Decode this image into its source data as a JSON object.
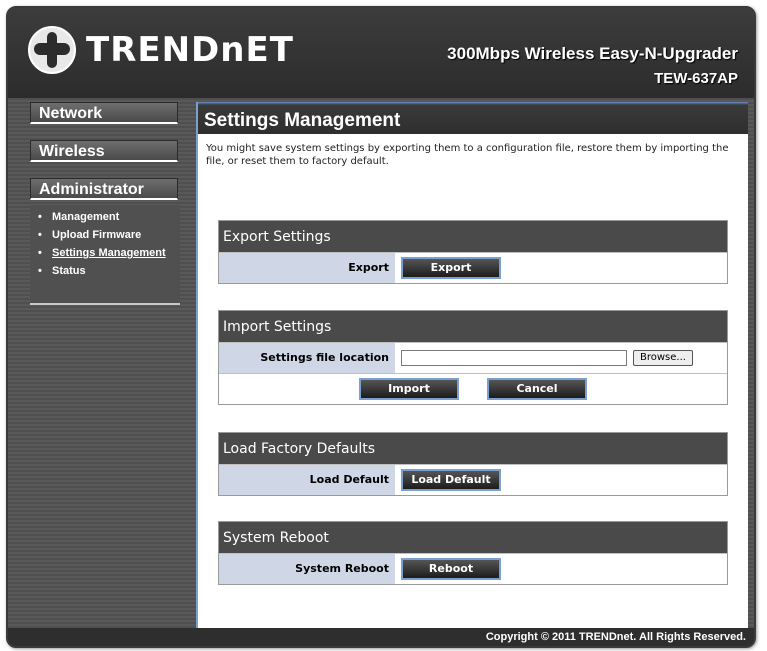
{
  "header": {
    "logo_text": "TRENDnET",
    "product_title": "300Mbps Wireless Easy-N-Upgrader",
    "model": "TEW-637AP"
  },
  "sidebar": {
    "nav": [
      {
        "label": "Network"
      },
      {
        "label": "Wireless"
      },
      {
        "label": "Administrator"
      }
    ],
    "submenu": [
      {
        "label": "Management"
      },
      {
        "label": "Upload Firmware"
      },
      {
        "label": "Settings Management"
      },
      {
        "label": "Status"
      }
    ]
  },
  "main": {
    "title": "Settings Management",
    "intro": "You might save system settings by exporting them to a configuration file, restore them by importing the file, or reset them to factory default."
  },
  "export": {
    "title": "Export Settings",
    "label": "Export",
    "button": "Export"
  },
  "import": {
    "title": "Import Settings",
    "label": "Settings file location",
    "file_value": "",
    "browse": "Browse...",
    "import_button": "Import",
    "cancel_button": "Cancel"
  },
  "load": {
    "title": "Load Factory Defaults",
    "label": "Load Default",
    "button": "Load Default"
  },
  "reboot": {
    "title": "System Reboot",
    "label": "System Reboot",
    "button": "Reboot"
  },
  "footer": {
    "copyright": "Copyright © 2011 TRENDnet. All Rights Reserved."
  },
  "colors": {
    "accent": "#7aa0d0",
    "header_bg": "#2e2e2e",
    "label_bg": "#cfd6e6"
  }
}
